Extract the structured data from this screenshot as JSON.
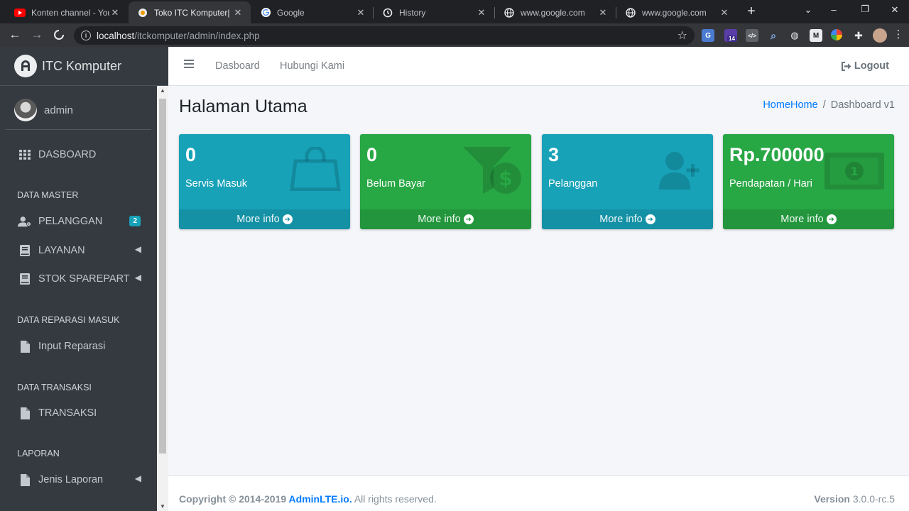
{
  "browser": {
    "tabs": [
      {
        "title": "Konten channel - YouTube",
        "icon": "youtube-icon",
        "active": false
      },
      {
        "title": "Toko ITC Komputer| Dashboard",
        "icon": "page-icon",
        "active": true
      },
      {
        "title": "Google",
        "icon": "google-icon",
        "active": false
      },
      {
        "title": "History",
        "icon": "history-icon",
        "active": false
      },
      {
        "title": "www.google.com",
        "icon": "globe-icon",
        "active": false
      },
      {
        "title": "www.google.com",
        "icon": "globe-icon",
        "active": false
      }
    ],
    "url_host": "localhost",
    "url_path": "/itckomputer/admin/index.php",
    "extension_badge": "14"
  },
  "sidebar": {
    "brand": "ITC Komputer",
    "user": "admin",
    "items": [
      {
        "label": "DASBOARD",
        "icon": "grid-icon"
      },
      {
        "header": "DATA MASTER"
      },
      {
        "label": "PELANGGAN",
        "icon": "user-icon",
        "badge": "2"
      },
      {
        "label": "LAYANAN",
        "icon": "book-icon",
        "chevron": true
      },
      {
        "label": "STOK SPAREPART",
        "icon": "book-icon",
        "chevron": true
      },
      {
        "header": "DATA REPARASI MASUK"
      },
      {
        "label": "Input Reparasi",
        "icon": "file-icon"
      },
      {
        "header": "DATA TRANSAKSI"
      },
      {
        "label": "TRANSAKSI",
        "icon": "file-icon"
      },
      {
        "header": "LAPORAN"
      },
      {
        "label": "Jenis Laporan",
        "icon": "file-icon",
        "chevron": true
      }
    ]
  },
  "topnav": {
    "links": [
      "Dasboard",
      "Hubungi Kami"
    ],
    "logout": "Logout"
  },
  "content": {
    "title": "Halaman Utama",
    "breadcrumb": {
      "home": "HomeHome",
      "separator": "/",
      "current": "Dashboard v1"
    },
    "boxes": [
      {
        "value": "0",
        "label": "Servis Masuk",
        "link": "More info",
        "color": "#17a2b8",
        "icon": "shopping-bag-icon"
      },
      {
        "value": "0",
        "label": "Belum Bayar",
        "link": "More info",
        "color": "#28a745",
        "icon": "funnel-dollar-icon"
      },
      {
        "value": "3",
        "label": "Pelanggan",
        "link": "More info",
        "color": "#17a2b8",
        "icon": "user-plus-icon"
      },
      {
        "value": "Rp.700000",
        "label": "Pendapatan / Hari",
        "link": "More info",
        "color": "#28a745",
        "icon": "money-bill-icon"
      }
    ]
  },
  "footer": {
    "copyright_prefix": "Copyright © 2014-2019 ",
    "brand": "AdminLTE.io.",
    "suffix": " All rights reserved.",
    "version_label": "Version",
    "version": " 3.0.0-rc.5"
  }
}
